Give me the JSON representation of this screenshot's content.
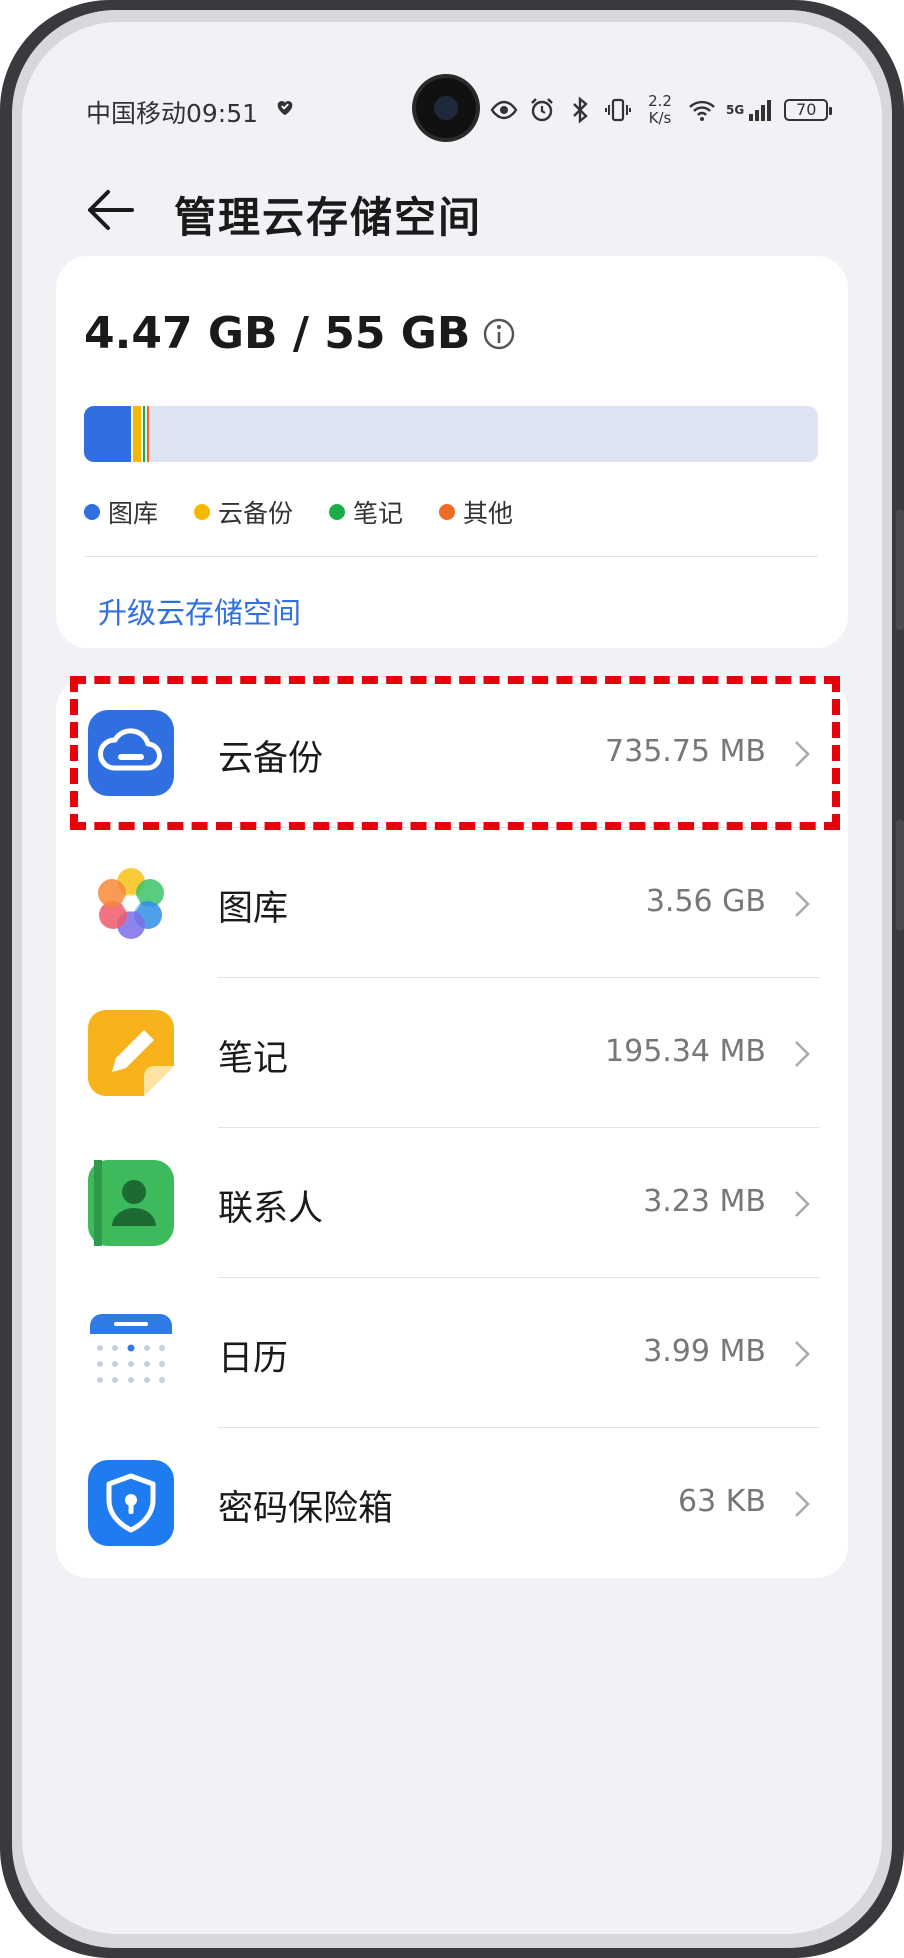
{
  "status_bar": {
    "carrier_time": "中国移动09:51",
    "net_speed_value": "2.2",
    "net_speed_unit": "K/s",
    "signal_label": "5G",
    "battery": "70"
  },
  "header": {
    "title": "管理云存储空间"
  },
  "storage": {
    "usage": "4.47 GB / 55 GB",
    "used_fraction": 0.0813,
    "segments": [
      {
        "name": "图库",
        "color": "#2f6fe0",
        "fraction": 0.0647
      },
      {
        "name": "云备份",
        "color": "#f5b700",
        "fraction": 0.0131
      },
      {
        "name": "笔记",
        "color": "#1aae49",
        "fraction": 0.0035
      },
      {
        "name": "其他",
        "color": "#ef6a25",
        "fraction": 0.0008
      }
    ],
    "legend": [
      {
        "label": "图库",
        "color": "#2f6fe0"
      },
      {
        "label": "云备份",
        "color": "#f5b700"
      },
      {
        "label": "笔记",
        "color": "#1aae49"
      },
      {
        "label": "其他",
        "color": "#ef6a25"
      }
    ],
    "upgrade_label": "升级云存储空间"
  },
  "apps": [
    {
      "label": "云备份",
      "size": "735.75 MB",
      "icon": "cloud-backup-icon"
    },
    {
      "label": "图库",
      "size": "3.56 GB",
      "icon": "gallery-icon"
    },
    {
      "label": "笔记",
      "size": "195.34 MB",
      "icon": "notes-icon"
    },
    {
      "label": "联系人",
      "size": "3.23 MB",
      "icon": "contacts-icon"
    },
    {
      "label": "日历",
      "size": "3.99 MB",
      "icon": "calendar-icon"
    },
    {
      "label": "密码保险箱",
      "size": "63 KB",
      "icon": "password-vault-icon"
    }
  ],
  "colors": {
    "accent": "#2f6fe0",
    "highlight": "#e8000b"
  }
}
